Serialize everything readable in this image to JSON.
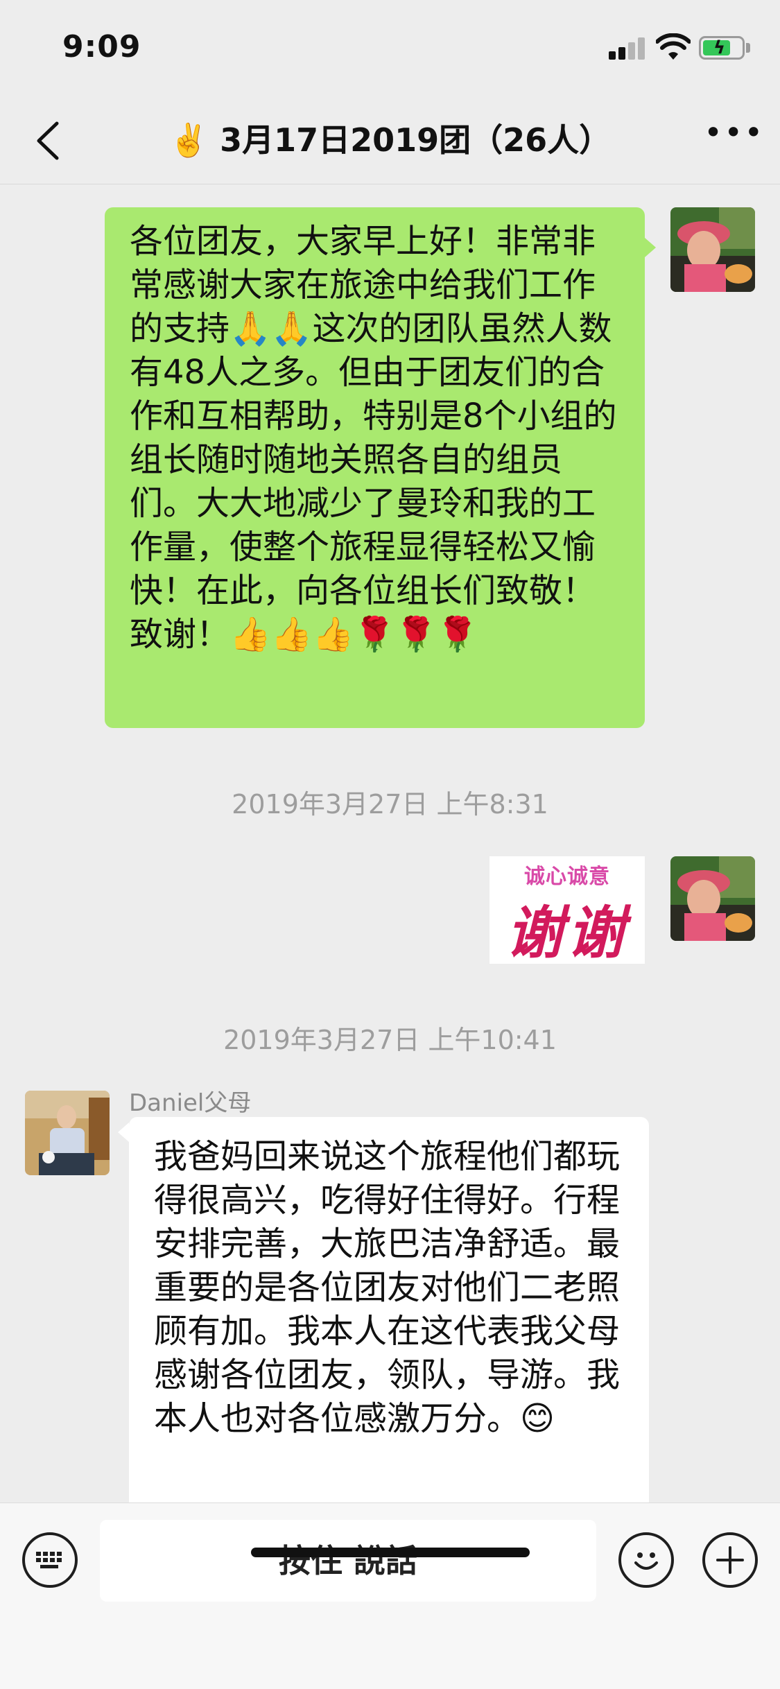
{
  "status": {
    "time": "9:09"
  },
  "nav": {
    "title": "✌️ 3月17日2019团（26人）"
  },
  "messages": {
    "m1": {
      "text": "各位团友，大家早上好！非常非常感谢大家在旅途中给我们工作的支持🙏🙏这次的团队虽然人数有48人之多。但由于团友们的合作和互相帮助，特别是8个小组的组长随时随地关照各自的组员们。大大地减少了曼玲和我的工作量，使整个旅程显得轻松又愉快！在此，向各位组长们致敬！致谢！👍👍👍🌹🌹🌹"
    },
    "ts1": "2019年3月27日 上午8:31",
    "sticker": {
      "line1": "诚心诚意",
      "line2": "谢谢"
    },
    "ts2": "2019年3月27日 上午10:41",
    "m2": {
      "sender": "Daniel父母",
      "text": "我爸妈回来说这个旅程他们都玩得很高兴，吃得好住得好。行程安排完善，大旅巴洁净舒适。最重要的是各位团友对他们二老照顾有加。我本人在这代表我父母感谢各位团友，领队，导游。我本人也对各位感激万分。😊"
    }
  },
  "input": {
    "hold_label": "按住 說話"
  },
  "colors": {
    "bubble_green": "#a9e96f",
    "background": "#ededed"
  }
}
